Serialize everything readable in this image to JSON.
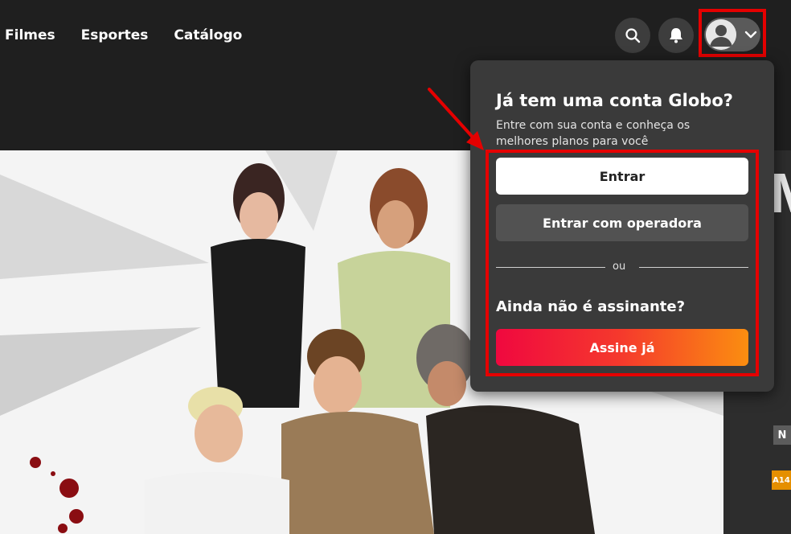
{
  "nav": {
    "items": [
      {
        "label": "Filmes"
      },
      {
        "label": "Esportes"
      },
      {
        "label": "Catálogo"
      }
    ]
  },
  "header": {
    "search_icon": "search-icon",
    "notification_icon": "bell-icon",
    "account_icon": "user-avatar-icon",
    "dropdown_icon": "chevron-down-icon"
  },
  "dropdown": {
    "title": "Já tem uma conta Globo?",
    "subtitle": "Entre com sua conta e conheça os melhores planos para você",
    "login_label": "Entrar",
    "operator_label": "Entrar com operadora",
    "separator": "ou",
    "not_subscriber": "Ainda não é assinante?",
    "subscribe_label": "Assine já"
  },
  "hero": {
    "side_letter": "M",
    "badge_n": "N",
    "rating_badge": "A14"
  },
  "colors": {
    "highlight": "#e50000",
    "subscribe_start": "#f0083f",
    "subscribe_end": "#fb8e10",
    "background": "#1f1f1f"
  }
}
